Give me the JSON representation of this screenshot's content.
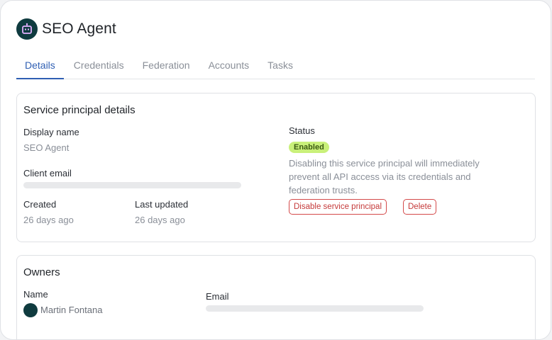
{
  "header": {
    "title": "SEO Agent",
    "logo_icon": "robot-icon"
  },
  "tabs": [
    {
      "label": "Details",
      "active": true
    },
    {
      "label": "Credentials",
      "active": false
    },
    {
      "label": "Federation",
      "active": false
    },
    {
      "label": "Accounts",
      "active": false
    },
    {
      "label": "Tasks",
      "active": false
    }
  ],
  "details": {
    "card_title": "Service principal details",
    "display_name_label": "Display name",
    "display_name_value": "SEO Agent",
    "client_email_label": "Client email",
    "created_label": "Created",
    "created_value": "26 days ago",
    "last_updated_label": "Last updated",
    "last_updated_value": "26 days ago",
    "status_label": "Status",
    "status_value": "Enabled",
    "status_help": "Disabling this service principal will immediately prevent all API access via its credentials and federation trusts.",
    "disable_button": "Disable service principal",
    "delete_button": "Delete"
  },
  "owners": {
    "card_title": "Owners",
    "name_label": "Name",
    "email_label": "Email",
    "owner_name": "Martin Fontana"
  },
  "colors": {
    "accent": "#2f5fb3",
    "brand_dark": "#0f3b3f",
    "status_enabled_bg": "#c9f07a",
    "danger": "#c53a3a"
  }
}
